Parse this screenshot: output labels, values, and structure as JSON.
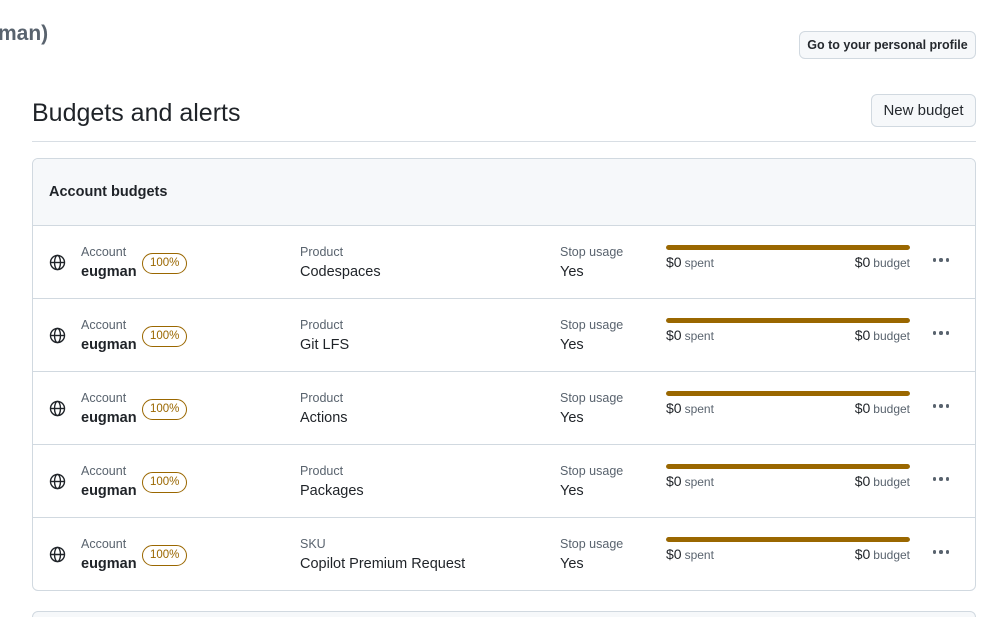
{
  "header": {
    "owner_fragment": "man)",
    "profile_button": "Go to your personal profile"
  },
  "page": {
    "title": "Budgets and alerts",
    "new_budget_button": "New budget"
  },
  "budgets": {
    "section_title": "Account budgets",
    "rows": [
      {
        "account_label": "Account",
        "account": "eugman",
        "alert_pct": "100%",
        "product_label": "Product",
        "product": "Codespaces",
        "stop_label": "Stop usage",
        "stop": "Yes",
        "spent": "$0",
        "spent_label": "spent",
        "budget": "$0",
        "budget_label": "budget",
        "progress": 1.0
      },
      {
        "account_label": "Account",
        "account": "eugman",
        "alert_pct": "100%",
        "product_label": "Product",
        "product": "Git LFS",
        "stop_label": "Stop usage",
        "stop": "Yes",
        "spent": "$0",
        "spent_label": "spent",
        "budget": "$0",
        "budget_label": "budget",
        "progress": 1.0
      },
      {
        "account_label": "Account",
        "account": "eugman",
        "alert_pct": "100%",
        "product_label": "Product",
        "product": "Actions",
        "stop_label": "Stop usage",
        "stop": "Yes",
        "spent": "$0",
        "spent_label": "spent",
        "budget": "$0",
        "budget_label": "budget",
        "progress": 1.0
      },
      {
        "account_label": "Account",
        "account": "eugman",
        "alert_pct": "100%",
        "product_label": "Product",
        "product": "Packages",
        "stop_label": "Stop usage",
        "stop": "Yes",
        "spent": "$0",
        "spent_label": "spent",
        "budget": "$0",
        "budget_label": "budget",
        "progress": 1.0
      },
      {
        "account_label": "Account",
        "account": "eugman",
        "alert_pct": "100%",
        "product_label": "SKU",
        "product": "Copilot Premium Request",
        "stop_label": "Stop usage",
        "stop": "Yes",
        "spent": "$0",
        "spent_label": "spent",
        "budget": "$0",
        "budget_label": "budget",
        "progress": 1.0
      }
    ]
  },
  "icons": {
    "row_icon": "globe-icon",
    "row_menu": "kebab-horizontal-icon"
  },
  "colors": {
    "attention": "#9a6700",
    "muted_text": "#59636e",
    "border": "#d1d9e0",
    "header_bg": "#f6f8fa"
  }
}
